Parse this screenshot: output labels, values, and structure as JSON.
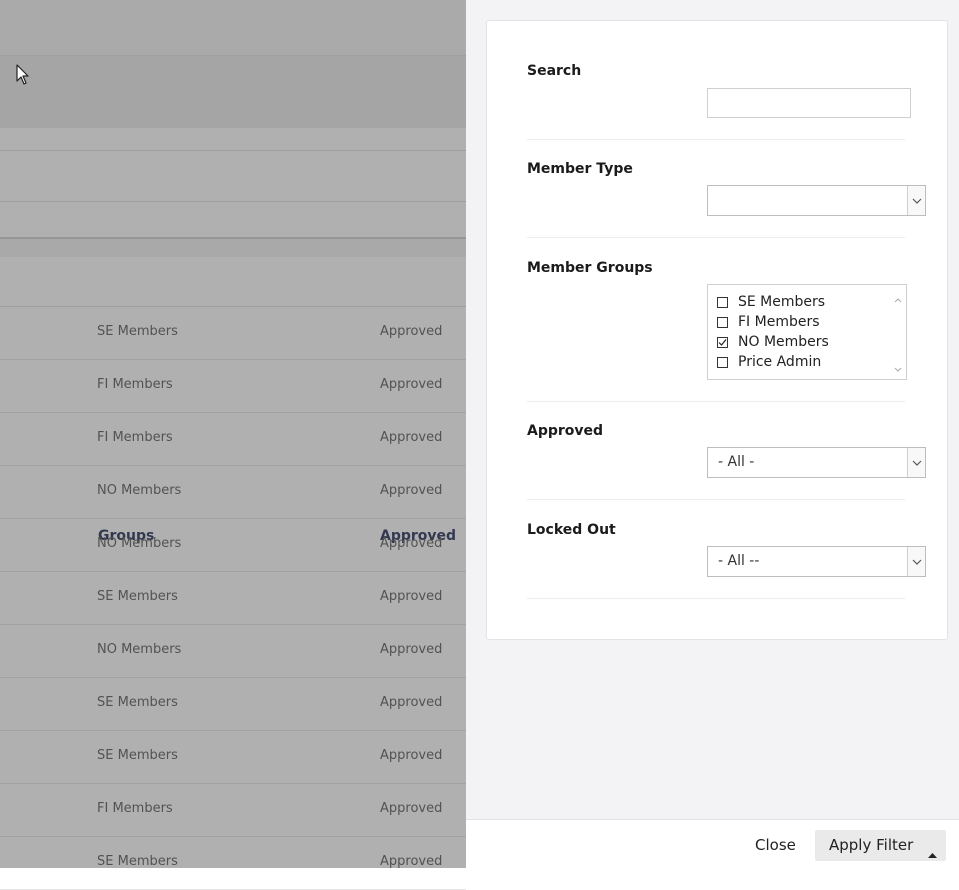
{
  "filter": {
    "search": {
      "label": "Search",
      "value": ""
    },
    "member_type": {
      "label": "Member Type",
      "value": ""
    },
    "member_groups": {
      "label": "Member Groups",
      "options": [
        {
          "label": "SE Members",
          "checked": false
        },
        {
          "label": "FI Members",
          "checked": false
        },
        {
          "label": "NO Members",
          "checked": true
        },
        {
          "label": "Price Admin",
          "checked": false
        }
      ]
    },
    "approved": {
      "label": "Approved",
      "value": "- All -"
    },
    "locked_out": {
      "label": "Locked Out",
      "value": "- All --"
    }
  },
  "footer": {
    "close_label": "Close",
    "apply_label": "Apply Filter"
  },
  "list": {
    "columns": {
      "groups": "Groups",
      "approved": "Approved"
    },
    "rows": [
      {
        "group": "SE Members",
        "approved": "Approved"
      },
      {
        "group": "FI Members",
        "approved": "Approved"
      },
      {
        "group": "FI Members",
        "approved": "Approved"
      },
      {
        "group": "NO Members",
        "approved": "Approved"
      },
      {
        "group": "NO Members",
        "approved": "Approved"
      },
      {
        "group": "SE Members",
        "approved": "Approved"
      },
      {
        "group": "NO Members",
        "approved": "Approved"
      },
      {
        "group": "SE Members",
        "approved": "Approved"
      },
      {
        "group": "SE Members",
        "approved": "Approved"
      },
      {
        "group": "FI Members",
        "approved": "Approved"
      },
      {
        "group": "SE Members",
        "approved": "Approved"
      }
    ]
  }
}
